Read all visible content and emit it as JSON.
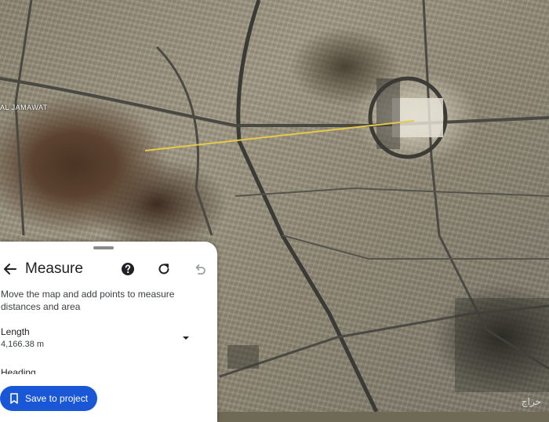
{
  "map": {
    "place_label": "AL JAMAWAT",
    "watermark": "حراج",
    "measure_line_color": "#e6c94a"
  },
  "panel": {
    "title": "Measure",
    "description": "Move the map and add points to measure distances and area",
    "length_label": "Length",
    "length_value": "4,166.38 m",
    "heading_label": "Heading",
    "save_label": "Save to project",
    "accent_color": "#1a57d6"
  },
  "icons": {
    "back": "arrow-left-icon",
    "help": "help-circle-icon",
    "refresh": "refresh-icon",
    "undo": "undo-icon",
    "dropdown": "dropdown-arrow-icon",
    "bookmark": "bookmark-icon"
  }
}
